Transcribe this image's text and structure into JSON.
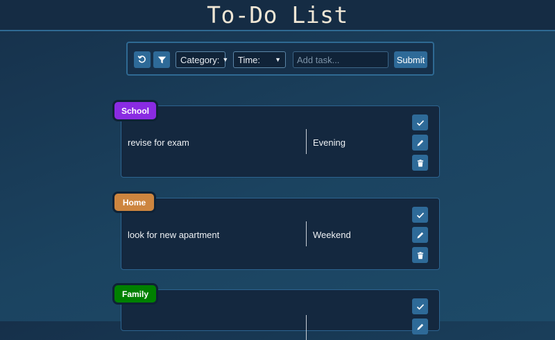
{
  "header": {
    "title": "To-Do List"
  },
  "toolbar": {
    "reset_icon": "reset-icon",
    "filter_icon": "filter-icon",
    "category_select": "Category:",
    "time_select": "Time:",
    "task_placeholder": "Add task...",
    "submit_label": "Submit"
  },
  "tasks": [
    {
      "category": "School",
      "category_color": "#8a2be2",
      "text": "revise for exam",
      "time": "Evening"
    },
    {
      "category": "Home",
      "category_color": "#cd853f",
      "text": "look for new apartment",
      "time": "Weekend"
    },
    {
      "category": "Family",
      "category_color": "#008000",
      "text": "",
      "time": ""
    }
  ],
  "actions": {
    "complete_icon": "check-icon",
    "edit_icon": "pencil-icon",
    "delete_icon": "trash-icon"
  }
}
